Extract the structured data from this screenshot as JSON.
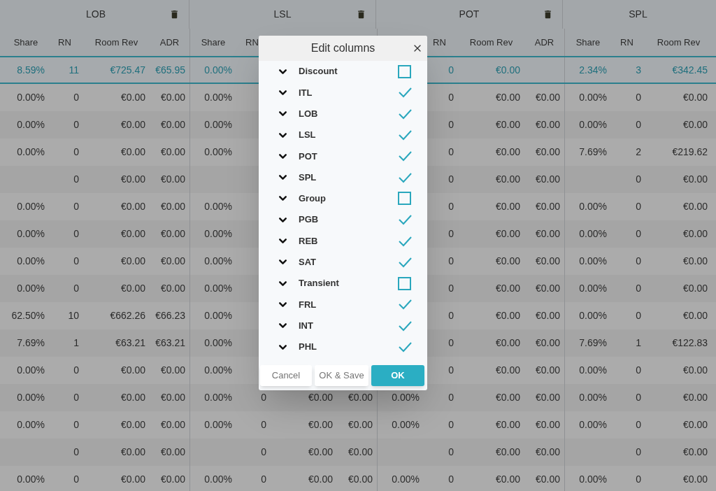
{
  "table": {
    "groups": [
      {
        "title": "LOB",
        "deletable": true,
        "columns": {
          "share": "Share",
          "rn": "RN",
          "room_rev": "Room Rev",
          "adr": "ADR"
        }
      },
      {
        "title": "LSL",
        "deletable": true,
        "columns": {
          "share": "Share",
          "rn": "RN"
        }
      },
      {
        "title": "POT",
        "deletable": true,
        "columns": {
          "rn": "RN",
          "room_rev": "Room Rev",
          "adr": "ADR"
        }
      },
      {
        "title": "SPL",
        "columns": {
          "share": "Share",
          "rn": "RN",
          "room_rev": "Room Rev"
        }
      }
    ],
    "total_row": [
      {
        "share": "8.59%",
        "rn": "11",
        "room_rev": "€725.47",
        "adr": "€65.95"
      },
      {
        "share": "0.00%"
      },
      {
        "rn": "0",
        "room_rev": "€0.00"
      },
      {
        "share": "2.34%",
        "rn": "3",
        "room_rev": "€342.45"
      }
    ],
    "rows": [
      {
        "cells": [
          {
            "share": "0.00%",
            "rn": "0",
            "room_rev": "€0.00",
            "adr": "€0.00"
          },
          {
            "share": "0.00%"
          },
          {
            "rn": "0",
            "room_rev": "€0.00",
            "adr": "€0.00"
          },
          {
            "share": "0.00%",
            "rn": "0",
            "room_rev": "€0.00"
          }
        ]
      },
      {
        "cells": [
          {
            "share": "0.00%",
            "rn": "0",
            "room_rev": "€0.00",
            "adr": "€0.00"
          },
          {
            "share": "0.00%"
          },
          {
            "rn": "0",
            "room_rev": "€0.00",
            "adr": "€0.00"
          },
          {
            "share": "0.00%",
            "rn": "0",
            "room_rev": "€0.00"
          }
        ]
      },
      {
        "cells": [
          {
            "share": "0.00%",
            "rn": "0",
            "room_rev": "€0.00",
            "adr": "€0.00"
          },
          {
            "share": "0.00%"
          },
          {
            "rn": "0",
            "room_rev": "€0.00",
            "adr": "€0.00"
          },
          {
            "share": "7.69%",
            "rn": "2",
            "room_rev": "€219.62"
          }
        ]
      },
      {
        "cells": [
          {
            "rn": "0",
            "room_rev": "€0.00",
            "adr": "€0.00"
          },
          {},
          {
            "rn": "0",
            "room_rev": "€0.00",
            "adr": "€0.00"
          },
          {
            "rn": "0",
            "room_rev": "€0.00"
          }
        ]
      },
      {
        "cells": [
          {
            "share": "0.00%",
            "rn": "0",
            "room_rev": "€0.00",
            "adr": "€0.00"
          },
          {
            "share": "0.00%"
          },
          {
            "rn": "0",
            "room_rev": "€0.00",
            "adr": "€0.00"
          },
          {
            "share": "0.00%",
            "rn": "0",
            "room_rev": "€0.00"
          }
        ]
      },
      {
        "cells": [
          {
            "share": "0.00%",
            "rn": "0",
            "room_rev": "€0.00",
            "adr": "€0.00"
          },
          {
            "share": "0.00%"
          },
          {
            "rn": "0",
            "room_rev": "€0.00",
            "adr": "€0.00"
          },
          {
            "share": "0.00%",
            "rn": "0",
            "room_rev": "€0.00"
          }
        ]
      },
      {
        "cells": [
          {
            "share": "0.00%",
            "rn": "0",
            "room_rev": "€0.00",
            "adr": "€0.00"
          },
          {
            "share": "0.00%"
          },
          {
            "rn": "0",
            "room_rev": "€0.00",
            "adr": "€0.00"
          },
          {
            "share": "0.00%",
            "rn": "0",
            "room_rev": "€0.00"
          }
        ]
      },
      {
        "cells": [
          {
            "share": "0.00%",
            "rn": "0",
            "room_rev": "€0.00",
            "adr": "€0.00"
          },
          {
            "share": "0.00%"
          },
          {
            "rn": "0",
            "room_rev": "€0.00",
            "adr": "€0.00"
          },
          {
            "share": "0.00%",
            "rn": "0",
            "room_rev": "€0.00"
          }
        ]
      },
      {
        "cells": [
          {
            "share": "62.50%",
            "rn": "10",
            "room_rev": "€662.26",
            "adr": "€66.23"
          },
          {
            "share": "0.00%"
          },
          {
            "rn": "0",
            "room_rev": "€0.00",
            "adr": "€0.00"
          },
          {
            "share": "0.00%",
            "rn": "0",
            "room_rev": "€0.00"
          }
        ]
      },
      {
        "cells": [
          {
            "share": "7.69%",
            "rn": "1",
            "room_rev": "€63.21",
            "adr": "€63.21"
          },
          {
            "share": "0.00%"
          },
          {
            "rn": "0",
            "room_rev": "€0.00",
            "adr": "€0.00"
          },
          {
            "share": "7.69%",
            "rn": "1",
            "room_rev": "€122.83"
          }
        ]
      },
      {
        "cells": [
          {
            "share": "0.00%",
            "rn": "0",
            "room_rev": "€0.00",
            "adr": "€0.00"
          },
          {
            "share": "0.00%"
          },
          {
            "rn": "0",
            "room_rev": "€0.00",
            "adr": "€0.00"
          },
          {
            "share": "0.00%",
            "rn": "0",
            "room_rev": "€0.00"
          }
        ]
      },
      {
        "cells": [
          {
            "share": "0.00%",
            "rn": "0",
            "room_rev": "€0.00",
            "adr": "€0.00"
          },
          {
            "share": "0.00%",
            "rn": "0",
            "room_rev": "€0.00",
            "adr": "€0.00"
          },
          {
            "share": "0.00%",
            "rn": "0",
            "room_rev": "€0.00",
            "adr": "€0.00"
          },
          {
            "share": "0.00%",
            "rn": "0",
            "room_rev": "€0.00"
          }
        ]
      },
      {
        "cells": [
          {
            "share": "0.00%",
            "rn": "0",
            "room_rev": "€0.00",
            "adr": "€0.00"
          },
          {
            "share": "0.00%",
            "rn": "0",
            "room_rev": "€0.00",
            "adr": "€0.00"
          },
          {
            "share": "0.00%",
            "rn": "0",
            "room_rev": "€0.00",
            "adr": "€0.00"
          },
          {
            "share": "0.00%",
            "rn": "0",
            "room_rev": "€0.00"
          }
        ]
      },
      {
        "cells": [
          {
            "rn": "0",
            "room_rev": "€0.00",
            "adr": "€0.00"
          },
          {
            "rn": "0",
            "room_rev": "€0.00",
            "adr": "€0.00"
          },
          {
            "rn": "0",
            "room_rev": "€0.00",
            "adr": "€0.00"
          },
          {
            "rn": "0",
            "room_rev": "€0.00"
          }
        ]
      },
      {
        "cells": [
          {
            "share": "0.00%",
            "rn": "0",
            "room_rev": "€0.00",
            "adr": "€0.00"
          },
          {
            "share": "0.00%",
            "rn": "0",
            "room_rev": "€0.00",
            "adr": "€0.00"
          },
          {
            "share": "0.00%",
            "rn": "0",
            "room_rev": "€0.00",
            "adr": "€0.00"
          },
          {
            "share": "0.00%",
            "rn": "0",
            "room_rev": "€0.00"
          }
        ]
      }
    ]
  },
  "dialog": {
    "title": "Edit columns",
    "items": [
      {
        "label": "Discount",
        "checked": false
      },
      {
        "label": "ITL",
        "checked": true
      },
      {
        "label": "LOB",
        "checked": true
      },
      {
        "label": "LSL",
        "checked": true
      },
      {
        "label": "POT",
        "checked": true
      },
      {
        "label": "SPL",
        "checked": true
      },
      {
        "label": "Group",
        "checked": false
      },
      {
        "label": "PGB",
        "checked": true
      },
      {
        "label": "REB",
        "checked": true
      },
      {
        "label": "SAT",
        "checked": true
      },
      {
        "label": "Transient",
        "checked": false
      },
      {
        "label": "FRL",
        "checked": true
      },
      {
        "label": "INT",
        "checked": true
      },
      {
        "label": "PHL",
        "checked": true
      }
    ],
    "buttons": [
      {
        "label": "Cancel",
        "kind": "default"
      },
      {
        "label": "OK & Save",
        "kind": "default"
      },
      {
        "label": "OK",
        "kind": "primary"
      }
    ]
  }
}
